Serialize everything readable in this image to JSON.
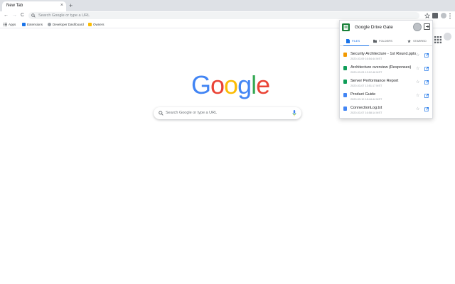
{
  "browser": {
    "tab_title": "New Tab",
    "tab_close": "×",
    "new_tab": "+",
    "omnibox_placeholder": "Search Google or type a URL"
  },
  "nav": {
    "back": "←",
    "forward": "→",
    "reload": "C"
  },
  "bookmarks": [
    {
      "label": "Apps",
      "icon": "apps-grid-icon",
      "color": "#5f6368"
    },
    {
      "label": "Extensions",
      "icon": "puzzle-icon",
      "color": "#1a73e8"
    },
    {
      "label": "Developer Dashboard",
      "icon": "dashboard-icon",
      "color": "#9aa0a6"
    },
    {
      "label": "Owners",
      "icon": "folder-icon",
      "color": "#fbbc04"
    }
  ],
  "google_logo": {
    "letters": [
      "G",
      "o",
      "o",
      "g",
      "l",
      "e"
    ],
    "colors": [
      "#4285f4",
      "#ea4335",
      "#fbbc05",
      "#4285f4",
      "#34a853",
      "#ea4335"
    ]
  },
  "search": {
    "placeholder": "Search Google or type a URL"
  },
  "popup": {
    "title": "Google Drive Gate",
    "tabs": [
      {
        "label": "FILES",
        "icon": "file-icon",
        "active": true
      },
      {
        "label": "FOLDERS",
        "icon": "folder-icon",
        "active": false
      },
      {
        "label": "STARRED",
        "icon": "star-icon",
        "active": false
      }
    ],
    "files": [
      {
        "name": "Security Architecture - 1st Round.pptx",
        "date": "2020-03-09 16:54:44 MST",
        "color": "#f29900",
        "type": "slides"
      },
      {
        "name": "Architecture overview (Responses)",
        "date": "2020-03-03 13:12:46 MST",
        "color": "#0f9d58",
        "type": "sheets"
      },
      {
        "name": "Server Performance Report",
        "date": "2020-03-07 13:51:17 MST",
        "color": "#0f9d58",
        "type": "sheets"
      },
      {
        "name": "Product Guide",
        "date": "2020-03-10 18:44:44 MST",
        "color": "#4285f4",
        "type": "docs"
      },
      {
        "name": "ConnectionLog.txt",
        "date": "2020-03-07 16:58:14 MST",
        "color": "#4285f4",
        "type": "docs"
      }
    ]
  },
  "colors": {
    "accent": "#1a73e8",
    "tabstrip": "#dee1e6"
  }
}
